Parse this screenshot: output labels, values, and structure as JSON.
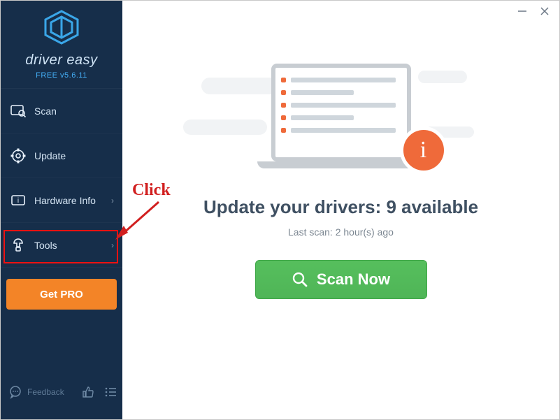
{
  "brand": {
    "name": "driver easy",
    "version": "FREE v5.6.11"
  },
  "sidebar": {
    "items": [
      {
        "label": "Scan",
        "icon": "scan-icon",
        "chevron": false
      },
      {
        "label": "Update",
        "icon": "update-icon",
        "chevron": false
      },
      {
        "label": "Hardware Info",
        "icon": "hardware-icon",
        "chevron": true
      },
      {
        "label": "Tools",
        "icon": "tools-icon",
        "chevron": true
      }
    ],
    "getpro_label": "Get PRO",
    "feedback_label": "Feedback"
  },
  "main": {
    "headline_prefix": "Update your drivers: ",
    "available_count": "9",
    "headline_suffix": " available",
    "last_scan": "Last scan: 2 hour(s) ago",
    "scan_button": "Scan Now",
    "info_glyph": "i"
  },
  "annotation": {
    "click": "Click"
  }
}
